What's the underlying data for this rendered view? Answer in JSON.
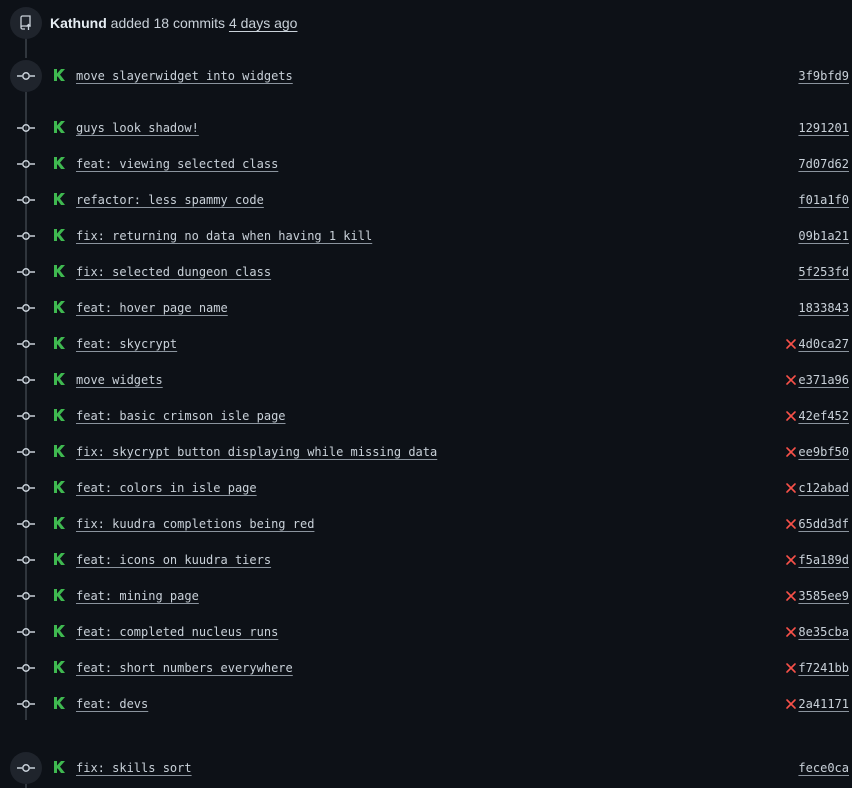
{
  "header": {
    "author": "Kathund",
    "action": "added 18 commits",
    "time": "4 days ago"
  },
  "colors": {
    "success": "#3fb950",
    "failure": "#f85149",
    "bg": "#0d1117",
    "line": "#30363d"
  },
  "icons": {
    "push": "repo-push-icon",
    "commit": "git-commit-icon",
    "author": "k-avatar-icon",
    "failure": "x-icon"
  },
  "commits": [
    {
      "message": "move slayerwidget into widgets",
      "sha": "3f9bfd9",
      "failed": false
    },
    {
      "message": "guys look shadow!",
      "sha": "1291201",
      "failed": false
    },
    {
      "message": "feat: viewing selected class",
      "sha": "7d07d62",
      "failed": false
    },
    {
      "message": "refactor: less spammy code",
      "sha": "f01a1f0",
      "failed": false
    },
    {
      "message": "fix: returning no data when having 1 kill",
      "sha": "09b1a21",
      "failed": false
    },
    {
      "message": "fix: selected dungeon class",
      "sha": "5f253fd",
      "failed": false
    },
    {
      "message": "feat: hover page name",
      "sha": "1833843",
      "failed": false
    },
    {
      "message": "feat: skycrypt",
      "sha": "4d0ca27",
      "failed": true
    },
    {
      "message": "move widgets",
      "sha": "e371a96",
      "failed": true
    },
    {
      "message": "feat: basic crimson isle page",
      "sha": "42ef452",
      "failed": true
    },
    {
      "message": "fix: skycrypt button displaying while missing data",
      "sha": "ee9bf50",
      "failed": true
    },
    {
      "message": "feat: colors in isle page",
      "sha": "c12abad",
      "failed": true
    },
    {
      "message": "fix: kuudra completions being red",
      "sha": "65dd3df",
      "failed": true
    },
    {
      "message": "feat: icons on kuudra tiers",
      "sha": "f5a189d",
      "failed": true
    },
    {
      "message": "feat: mining page",
      "sha": "3585ee9",
      "failed": true
    },
    {
      "message": "feat: completed nucleus runs",
      "sha": "8e35cba",
      "failed": true
    },
    {
      "message": "feat: short numbers everywhere",
      "sha": "f7241bb",
      "failed": true
    },
    {
      "message": "feat: devs",
      "sha": "2a41171",
      "failed": true
    }
  ],
  "last_commit": {
    "message": "fix: skills sort",
    "sha": "fece0ca",
    "failed": false
  }
}
